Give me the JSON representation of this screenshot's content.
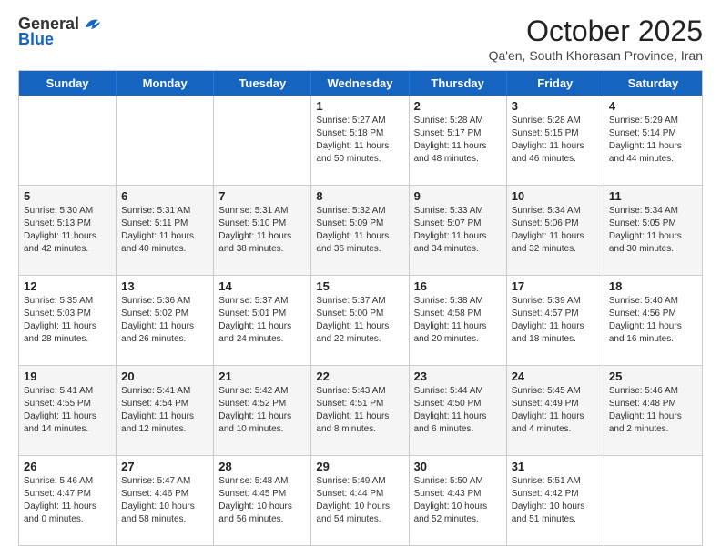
{
  "header": {
    "logo_general": "General",
    "logo_blue": "Blue",
    "month_title": "October 2025",
    "subtitle": "Qa'en, South Khorasan Province, Iran"
  },
  "days_of_week": [
    "Sunday",
    "Monday",
    "Tuesday",
    "Wednesday",
    "Thursday",
    "Friday",
    "Saturday"
  ],
  "rows": [
    {
      "cells": [
        {
          "day": "",
          "info": ""
        },
        {
          "day": "",
          "info": ""
        },
        {
          "day": "",
          "info": ""
        },
        {
          "day": "1",
          "info": "Sunrise: 5:27 AM\nSunset: 5:18 PM\nDaylight: 11 hours\nand 50 minutes."
        },
        {
          "day": "2",
          "info": "Sunrise: 5:28 AM\nSunset: 5:17 PM\nDaylight: 11 hours\nand 48 minutes."
        },
        {
          "day": "3",
          "info": "Sunrise: 5:28 AM\nSunset: 5:15 PM\nDaylight: 11 hours\nand 46 minutes."
        },
        {
          "day": "4",
          "info": "Sunrise: 5:29 AM\nSunset: 5:14 PM\nDaylight: 11 hours\nand 44 minutes."
        }
      ]
    },
    {
      "cells": [
        {
          "day": "5",
          "info": "Sunrise: 5:30 AM\nSunset: 5:13 PM\nDaylight: 11 hours\nand 42 minutes."
        },
        {
          "day": "6",
          "info": "Sunrise: 5:31 AM\nSunset: 5:11 PM\nDaylight: 11 hours\nand 40 minutes."
        },
        {
          "day": "7",
          "info": "Sunrise: 5:31 AM\nSunset: 5:10 PM\nDaylight: 11 hours\nand 38 minutes."
        },
        {
          "day": "8",
          "info": "Sunrise: 5:32 AM\nSunset: 5:09 PM\nDaylight: 11 hours\nand 36 minutes."
        },
        {
          "day": "9",
          "info": "Sunrise: 5:33 AM\nSunset: 5:07 PM\nDaylight: 11 hours\nand 34 minutes."
        },
        {
          "day": "10",
          "info": "Sunrise: 5:34 AM\nSunset: 5:06 PM\nDaylight: 11 hours\nand 32 minutes."
        },
        {
          "day": "11",
          "info": "Sunrise: 5:34 AM\nSunset: 5:05 PM\nDaylight: 11 hours\nand 30 minutes."
        }
      ]
    },
    {
      "cells": [
        {
          "day": "12",
          "info": "Sunrise: 5:35 AM\nSunset: 5:03 PM\nDaylight: 11 hours\nand 28 minutes."
        },
        {
          "day": "13",
          "info": "Sunrise: 5:36 AM\nSunset: 5:02 PM\nDaylight: 11 hours\nand 26 minutes."
        },
        {
          "day": "14",
          "info": "Sunrise: 5:37 AM\nSunset: 5:01 PM\nDaylight: 11 hours\nand 24 minutes."
        },
        {
          "day": "15",
          "info": "Sunrise: 5:37 AM\nSunset: 5:00 PM\nDaylight: 11 hours\nand 22 minutes."
        },
        {
          "day": "16",
          "info": "Sunrise: 5:38 AM\nSunset: 4:58 PM\nDaylight: 11 hours\nand 20 minutes."
        },
        {
          "day": "17",
          "info": "Sunrise: 5:39 AM\nSunset: 4:57 PM\nDaylight: 11 hours\nand 18 minutes."
        },
        {
          "day": "18",
          "info": "Sunrise: 5:40 AM\nSunset: 4:56 PM\nDaylight: 11 hours\nand 16 minutes."
        }
      ]
    },
    {
      "cells": [
        {
          "day": "19",
          "info": "Sunrise: 5:41 AM\nSunset: 4:55 PM\nDaylight: 11 hours\nand 14 minutes."
        },
        {
          "day": "20",
          "info": "Sunrise: 5:41 AM\nSunset: 4:54 PM\nDaylight: 11 hours\nand 12 minutes."
        },
        {
          "day": "21",
          "info": "Sunrise: 5:42 AM\nSunset: 4:52 PM\nDaylight: 11 hours\nand 10 minutes."
        },
        {
          "day": "22",
          "info": "Sunrise: 5:43 AM\nSunset: 4:51 PM\nDaylight: 11 hours\nand 8 minutes."
        },
        {
          "day": "23",
          "info": "Sunrise: 5:44 AM\nSunset: 4:50 PM\nDaylight: 11 hours\nand 6 minutes."
        },
        {
          "day": "24",
          "info": "Sunrise: 5:45 AM\nSunset: 4:49 PM\nDaylight: 11 hours\nand 4 minutes."
        },
        {
          "day": "25",
          "info": "Sunrise: 5:46 AM\nSunset: 4:48 PM\nDaylight: 11 hours\nand 2 minutes."
        }
      ]
    },
    {
      "cells": [
        {
          "day": "26",
          "info": "Sunrise: 5:46 AM\nSunset: 4:47 PM\nDaylight: 11 hours\nand 0 minutes."
        },
        {
          "day": "27",
          "info": "Sunrise: 5:47 AM\nSunset: 4:46 PM\nDaylight: 10 hours\nand 58 minutes."
        },
        {
          "day": "28",
          "info": "Sunrise: 5:48 AM\nSunset: 4:45 PM\nDaylight: 10 hours\nand 56 minutes."
        },
        {
          "day": "29",
          "info": "Sunrise: 5:49 AM\nSunset: 4:44 PM\nDaylight: 10 hours\nand 54 minutes."
        },
        {
          "day": "30",
          "info": "Sunrise: 5:50 AM\nSunset: 4:43 PM\nDaylight: 10 hours\nand 52 minutes."
        },
        {
          "day": "31",
          "info": "Sunrise: 5:51 AM\nSunset: 4:42 PM\nDaylight: 10 hours\nand 51 minutes."
        },
        {
          "day": "",
          "info": ""
        }
      ]
    }
  ]
}
